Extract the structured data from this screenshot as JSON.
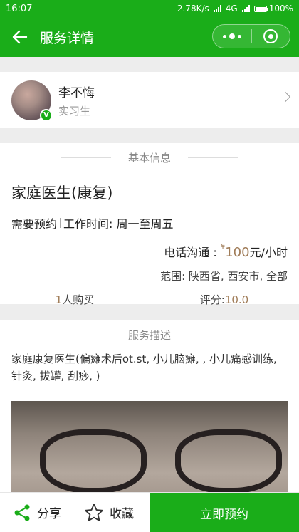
{
  "status_bar": {
    "time": "16:07",
    "speed": "2.78K/s",
    "network": "4G",
    "battery": "100%",
    "battery_level": 1.0
  },
  "nav": {
    "title": "服务详情"
  },
  "profile": {
    "name": "李不悔",
    "role": "实习生",
    "badge": "V"
  },
  "basic": {
    "section_title": "基本信息",
    "service_name": "家庭医生(康复)",
    "booking": "需要预约",
    "hours": "工作时间: 周一至周五",
    "price_label": "电话沟通 :",
    "price_symbol": "¥",
    "price": "100",
    "price_unit": "元/小时",
    "scope": "范围: 陕西省, 西安市, 全部",
    "buyers_count": "1",
    "buyers_label": "人购买",
    "rating_label": "评分:",
    "rating": "10.0"
  },
  "description": {
    "section_title": "服务描述",
    "text": "家庭康复医生(偏瘫术后ot.st, 小儿脑瘫, , 小儿痛感训练, 针灸, 拔罐, 刮痧, )"
  },
  "bottom_bar": {
    "share": "分享",
    "favorite": "收藏",
    "book": "立即预约"
  },
  "colors": {
    "brand_green": "#1aad19",
    "price": "#a07c58"
  },
  "icons": [
    "back-arrow-icon",
    "more-icon",
    "close-circle-icon",
    "verified-icon",
    "chevron-right-icon",
    "share-icon",
    "star-icon"
  ]
}
